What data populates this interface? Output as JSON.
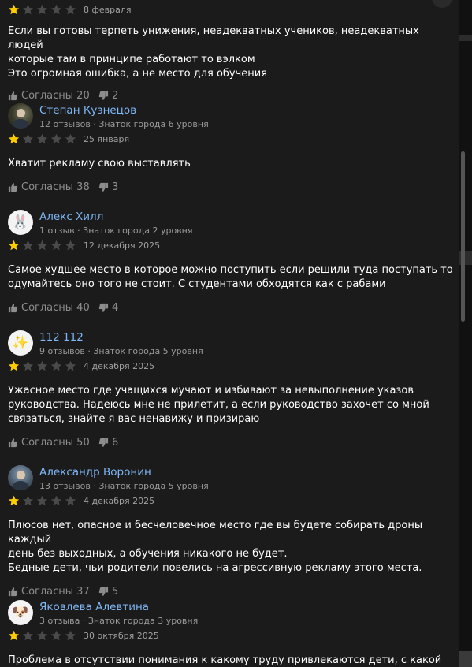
{
  "colors": {
    "background": "#1b1b1b",
    "author_name": "#7fb6f5",
    "star_filled": "#ffcc00",
    "star_empty": "#4a4a4a",
    "muted_text": "#9a9a9a"
  },
  "icons": {
    "like": "thumb-up-icon",
    "dislike": "thumb-down-icon",
    "star": "star-icon"
  },
  "reviews": [
    {
      "author": "",
      "meta": "",
      "rating": 1,
      "date": "8 февраля",
      "text": "Если вы готовы терпеть унижения, неадекватных учеников, неадекватных людей\nкоторые там в принципе работают то вэлком\nЭто огромная ошибка, а не место для обучения",
      "likes": "Согласны 20",
      "dislikes": "2"
    },
    {
      "author": "Степан Кузнецов",
      "meta": "12 отзывов · Знаток города 6 уровня",
      "rating": 1,
      "date": "25 января",
      "text": "Хватит рекламу свою выставлять",
      "likes": "Согласны 38",
      "dislikes": "3"
    },
    {
      "author": "Алекс Хилл",
      "meta": "1 отзыв · Знаток города 2 уровня",
      "avatar_glyph": "🐰",
      "rating": 1,
      "date": "12 декабря 2025",
      "text": "Самое худшее место в которое можно поступить если решили туда поступать то\nодумайтесь оно того не стоит. С студентами обходятся как с рабами",
      "likes": "Согласны 40",
      "dislikes": "4"
    },
    {
      "author": "112 112",
      "meta": "9 отзывов · Знаток города 5 уровня",
      "avatar_glyph": "✨",
      "rating": 1,
      "date": "4 декабря 2025",
      "text": "Ужасное место где учащихся мучают и избивают за невыполнение указов\nруководства. Надеюсь мне не прилетит, а если руководство захочет со мной\nсвязаться, знайте я вас ненавижу и призираю",
      "likes": "Согласны 50",
      "dislikes": "6"
    },
    {
      "author": "Александр Воронин",
      "meta": "13 отзывов · Знаток города 5 уровня",
      "rating": 1,
      "date": "4 декабря 2025",
      "text": "Плюсов нет, опасное и бесчеловечное место где вы будете собирать дроны каждый\nдень без выходных, а обучения никакого не будет.\nБедные дети, чьи родители повелись на агрессивную рекламу этого места.",
      "likes": "Согласны 37",
      "dislikes": "5"
    },
    {
      "author": "Яковлева Алевтина",
      "meta": "3 отзыва · Знаток города 3 уровня",
      "avatar_glyph": "🐶",
      "rating": 1,
      "date": "30 октября 2025",
      "text": "Проблема в отсутствии понимания к какому труду привлекаются дети, с какой",
      "likes": "",
      "dislikes": ""
    }
  ]
}
